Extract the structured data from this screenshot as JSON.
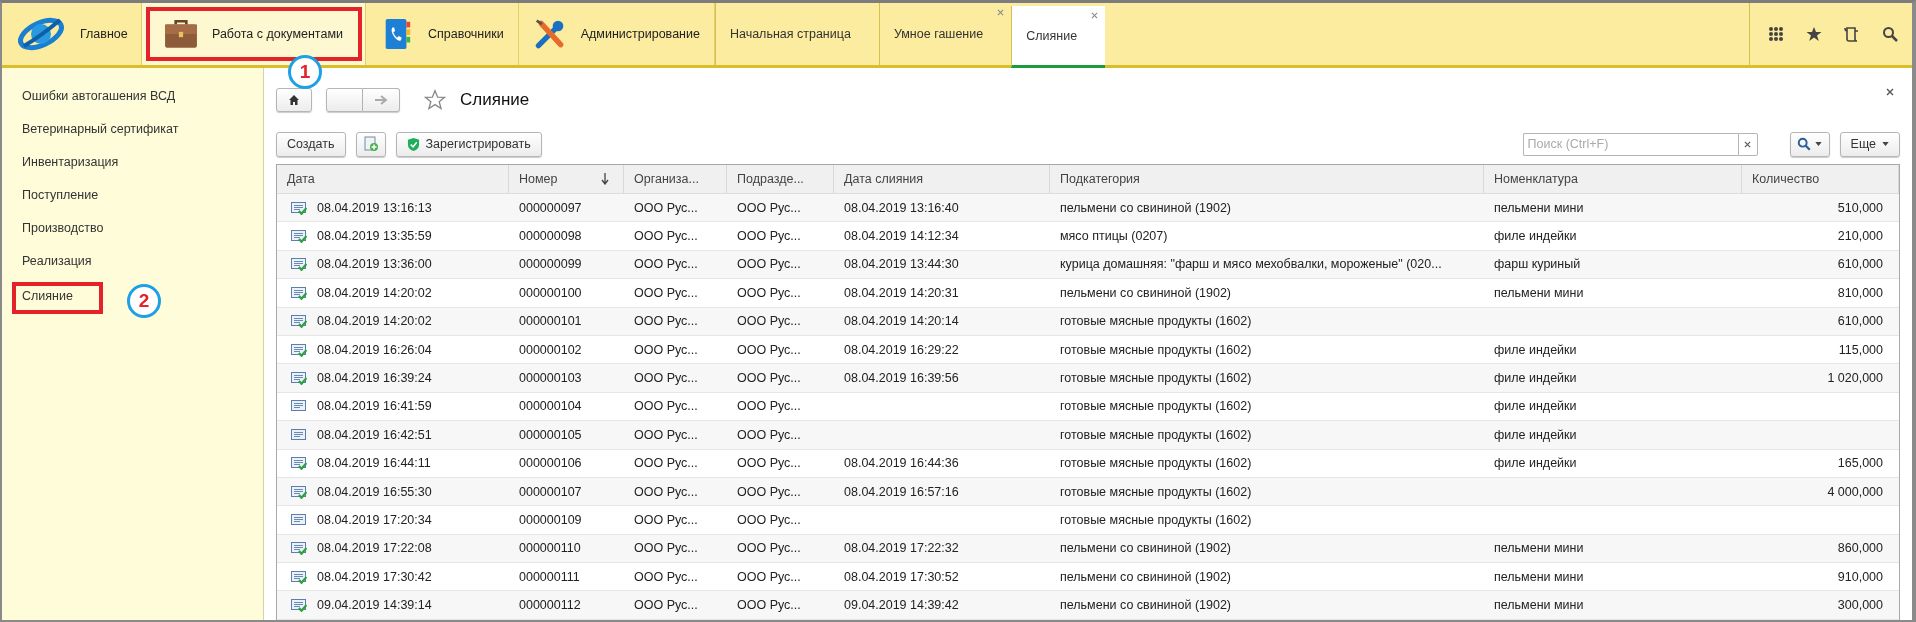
{
  "sections": [
    {
      "label": "Главное",
      "kind": "logo",
      "highlighted": false
    },
    {
      "label": "Работа с документами",
      "kind": "briefcase",
      "highlighted": true,
      "callout": "1"
    },
    {
      "label": "Справочники",
      "kind": "book",
      "highlighted": false
    },
    {
      "label": "Администрирование",
      "kind": "tools",
      "highlighted": false
    }
  ],
  "tabs": [
    {
      "label": "Начальная страница",
      "closable": false,
      "selected": false
    },
    {
      "label": "Умное гашение",
      "closable": true,
      "selected": false
    },
    {
      "label": "Слияние",
      "closable": true,
      "selected": true
    }
  ],
  "sidebar": {
    "items": [
      {
        "label": "Ошибки автогашения ВСД",
        "highlighted": false
      },
      {
        "label": "Ветеринарный сертификат",
        "highlighted": false
      },
      {
        "label": "Инвентаризация",
        "highlighted": false
      },
      {
        "label": "Поступление",
        "highlighted": false
      },
      {
        "label": "Производство",
        "highlighted": false
      },
      {
        "label": "Реализация",
        "highlighted": false
      },
      {
        "label": "Слияние",
        "highlighted": true,
        "callout": "2"
      }
    ]
  },
  "form": {
    "title": "Слияние",
    "toolbar": {
      "create": "Создать",
      "register": "Зарегистрировать",
      "search": {
        "placeholder": "Поиск (Ctrl+F)"
      },
      "more": "Еще"
    }
  },
  "table": {
    "columns": [
      {
        "label": "Дата",
        "sorted": false
      },
      {
        "label": "Номер",
        "sorted": true
      },
      {
        "label": "Организа...",
        "sorted": false
      },
      {
        "label": "Подразде...",
        "sorted": false
      },
      {
        "label": "Дата слияния",
        "sorted": false
      },
      {
        "label": "Подкатегория",
        "sorted": false
      },
      {
        "label": "Номенклатура",
        "sorted": false
      },
      {
        "label": "Количество",
        "sorted": false
      }
    ],
    "rows": [
      {
        "posted": true,
        "date": "08.04.2019 13:16:13",
        "number": "000000097",
        "org": "ООО Рус...",
        "dept": "ООО Рус...",
        "merge_date": "08.04.2019 13:16:40",
        "subcategory": "пельмени со свининой (1902)",
        "nomenclature": "пельмени мини",
        "quantity": "510,000"
      },
      {
        "posted": true,
        "date": "08.04.2019 13:35:59",
        "number": "000000098",
        "org": "ООО Рус...",
        "dept": "ООО Рус...",
        "merge_date": "08.04.2019 14:12:34",
        "subcategory": "мясо птицы (0207)",
        "nomenclature": "филе индейки",
        "quantity": "210,000"
      },
      {
        "posted": true,
        "date": "08.04.2019 13:36:00",
        "number": "000000099",
        "org": "ООО Рус...",
        "dept": "ООО Рус...",
        "merge_date": "08.04.2019 13:44:30",
        "subcategory": "курица домашняя: \"фарш и мясо мехобвалки, мороженые\" (020...",
        "nomenclature": "фарш куриный",
        "quantity": "610,000"
      },
      {
        "posted": true,
        "date": "08.04.2019 14:20:02",
        "number": "000000100",
        "org": "ООО Рус...",
        "dept": "ООО Рус...",
        "merge_date": "08.04.2019 14:20:31",
        "subcategory": "пельмени со свининой (1902)",
        "nomenclature": "пельмени мини",
        "quantity": "810,000"
      },
      {
        "posted": true,
        "date": "08.04.2019 14:20:02",
        "number": "000000101",
        "org": "ООО Рус...",
        "dept": "ООО Рус...",
        "merge_date": "08.04.2019 14:20:14",
        "subcategory": "готовые мясные продукты (1602)",
        "quantity": "610,000"
      },
      {
        "posted": true,
        "date": "08.04.2019 16:26:04",
        "number": "000000102",
        "org": "ООО Рус...",
        "dept": "ООО Рус...",
        "merge_date": "08.04.2019 16:29:22",
        "subcategory": "готовые мясные продукты (1602)",
        "nomenclature": "филе индейки",
        "quantity": "115,000"
      },
      {
        "posted": true,
        "date": "08.04.2019 16:39:24",
        "number": "000000103",
        "org": "ООО Рус...",
        "dept": "ООО Рус...",
        "merge_date": "08.04.2019 16:39:56",
        "subcategory": "готовые мясные продукты (1602)",
        "nomenclature": "филе индейки",
        "quantity": "1 020,000"
      },
      {
        "posted": false,
        "date": "08.04.2019 16:41:59",
        "number": "000000104",
        "org": "ООО Рус...",
        "dept": "ООО Рус...",
        "subcategory": "готовые мясные продукты (1602)",
        "nomenclature": "филе индейки"
      },
      {
        "posted": false,
        "date": "08.04.2019 16:42:51",
        "number": "000000105",
        "org": "ООО Рус...",
        "dept": "ООО Рус...",
        "subcategory": "готовые мясные продукты (1602)",
        "nomenclature": "филе индейки"
      },
      {
        "posted": true,
        "date": "08.04.2019 16:44:11",
        "number": "000000106",
        "org": "ООО Рус...",
        "dept": "ООО Рус...",
        "merge_date": "08.04.2019 16:44:36",
        "subcategory": "готовые мясные продукты (1602)",
        "nomenclature": "филе индейки",
        "quantity": "165,000"
      },
      {
        "posted": true,
        "date": "08.04.2019 16:55:30",
        "number": "000000107",
        "org": "ООО Рус...",
        "dept": "ООО Рус...",
        "merge_date": "08.04.2019 16:57:16",
        "subcategory": "готовые мясные продукты (1602)",
        "quantity": "4 000,000"
      },
      {
        "posted": false,
        "date": "08.04.2019 17:20:34",
        "number": "000000109",
        "org": "ООО Рус...",
        "dept": "ООО Рус...",
        "subcategory": "готовые мясные продукты (1602)"
      },
      {
        "posted": true,
        "date": "08.04.2019 17:22:08",
        "number": "000000110",
        "org": "ООО Рус...",
        "dept": "ООО Рус...",
        "merge_date": "08.04.2019 17:22:32",
        "subcategory": "пельмени со свининой (1902)",
        "nomenclature": "пельмени мини",
        "quantity": "860,000"
      },
      {
        "posted": true,
        "date": "08.04.2019 17:30:42",
        "number": "000000111",
        "org": "ООО Рус...",
        "dept": "ООО Рус...",
        "merge_date": "08.04.2019 17:30:52",
        "subcategory": "пельмени со свининой (1902)",
        "nomenclature": "пельмени мини",
        "quantity": "910,000"
      },
      {
        "posted": true,
        "date": "09.04.2019 14:39:14",
        "number": "000000112",
        "org": "ООО Рус...",
        "dept": "ООО Рус...",
        "merge_date": "09.04.2019 14:39:42",
        "subcategory": "пельмени со свининой (1902)",
        "nomenclature": "пельмени мини",
        "quantity": "300,000"
      }
    ]
  }
}
